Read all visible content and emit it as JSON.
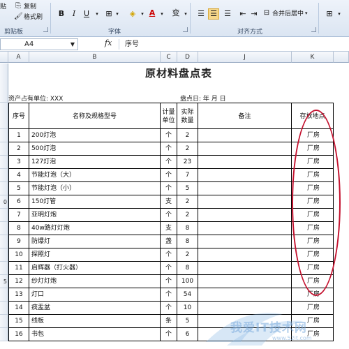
{
  "ribbon": {
    "clipboard": {
      "paste_label": "贴",
      "copy_label": "复制",
      "format_painter_label": "格式刷",
      "group_label": "剪贴板"
    },
    "font": {
      "bold": "B",
      "italic": "I",
      "underline": "U",
      "font_color_letter": "A",
      "wen": "变",
      "group_label": "字体"
    },
    "alignment": {
      "merge_label": "合并后居中",
      "group_label": "对齐方式"
    }
  },
  "formula_bar": {
    "name_box": "A4",
    "fx": "fx",
    "content": "序号"
  },
  "columns": [
    "A",
    "B",
    "C",
    "D",
    "J",
    "K"
  ],
  "sheet": {
    "title": "原材料盘点表",
    "owner_label": "资产占有单位: XXX",
    "date_label": "盘点日:   年   月   日",
    "headers": {
      "seq": "序号",
      "name": "名称及规格型号",
      "unit_1": "计量",
      "unit_2": "单位",
      "qty_1": "实际",
      "qty_2": "数量",
      "note": "备注",
      "location": "存放地点"
    },
    "rows": [
      {
        "rh": "",
        "no": "1",
        "name": "200灯泡",
        "unit": "个",
        "qty": "2",
        "loc": "厂房"
      },
      {
        "rh": "",
        "no": "2",
        "name": "500灯泡",
        "unit": "个",
        "qty": "2",
        "loc": "厂房"
      },
      {
        "rh": "",
        "no": "3",
        "name": "127灯泡",
        "unit": "个",
        "qty": "23",
        "loc": "厂房"
      },
      {
        "rh": "",
        "no": "4",
        "name": "节能灯泡（大）",
        "unit": "个",
        "qty": "7",
        "loc": "厂房"
      },
      {
        "rh": "",
        "no": "5",
        "name": "节能灯泡（小）",
        "unit": "个",
        "qty": "5",
        "loc": "厂房"
      },
      {
        "rh": "0",
        "no": "6",
        "name": "150灯管",
        "unit": "支",
        "qty": "2",
        "loc": "厂房"
      },
      {
        "rh": "",
        "no": "7",
        "name": "亚明灯炮",
        "unit": "个",
        "qty": "2",
        "loc": "厂房"
      },
      {
        "rh": "",
        "no": "8",
        "name": "40w路灯灯炮",
        "unit": "支",
        "qty": "8",
        "loc": "厂房"
      },
      {
        "rh": "",
        "no": "9",
        "name": "防爆灯",
        "unit": "盏",
        "qty": "8",
        "loc": "厂房"
      },
      {
        "rh": "",
        "no": "10",
        "name": "探照灯",
        "unit": "个",
        "qty": "2",
        "loc": "厂房"
      },
      {
        "rh": "",
        "no": "11",
        "name": "启辉器（打火器）",
        "unit": "个",
        "qty": "8",
        "loc": "厂房"
      },
      {
        "rh": "5",
        "no": "12",
        "name": "纱灯灯炮",
        "unit": "个",
        "qty": "100",
        "loc": "厂房"
      },
      {
        "rh": "",
        "no": "13",
        "name": "灯口",
        "unit": "个",
        "qty": "54",
        "loc": "厂房"
      },
      {
        "rh": "",
        "no": "14",
        "name": "痰盂盆",
        "unit": "个",
        "qty": "10",
        "loc": "厂房"
      },
      {
        "rh": "",
        "no": "15",
        "name": "线板",
        "unit": "条",
        "qty": "5",
        "loc": "厂房"
      },
      {
        "rh": "",
        "no": "16",
        "name": "书包",
        "unit": "个",
        "qty": "6",
        "loc": "厂房"
      }
    ]
  },
  "watermark": {
    "text": "我爱IT技术网",
    "sub": "www.52it.com"
  },
  "colors": {
    "annotation_oval": "#c4122f",
    "ribbon_bg": "#dbe5f2"
  }
}
